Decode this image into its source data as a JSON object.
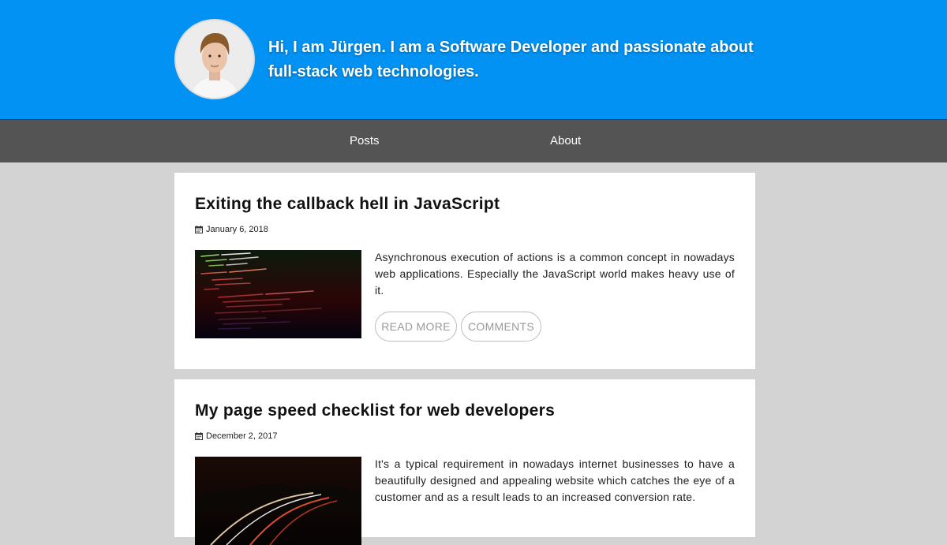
{
  "header": {
    "intro": "Hi, I am Jürgen. I am a Software Developer and passionate about full-stack web technologies.",
    "brand_color": "#0292f3"
  },
  "nav": {
    "items": [
      {
        "label": "Posts"
      },
      {
        "label": "About"
      }
    ]
  },
  "posts": [
    {
      "title": "Exiting the callback hell in JavaScript",
      "date": "January 6, 2018",
      "excerpt": "Asynchronous execution of actions is a common concept in nowadays web applications. Especially the JavaScript world makes heavy use of it.",
      "read_more": "READ MORE",
      "comments": "COMMENTS"
    },
    {
      "title": "My page speed checklist for web developers",
      "date": "December 2, 2017",
      "excerpt": "It's a typical requirement in nowadays internet businesses to have a beautifully designed and appealing website which catches the eye of a customer and as a result leads to an increased conversion rate."
    }
  ]
}
